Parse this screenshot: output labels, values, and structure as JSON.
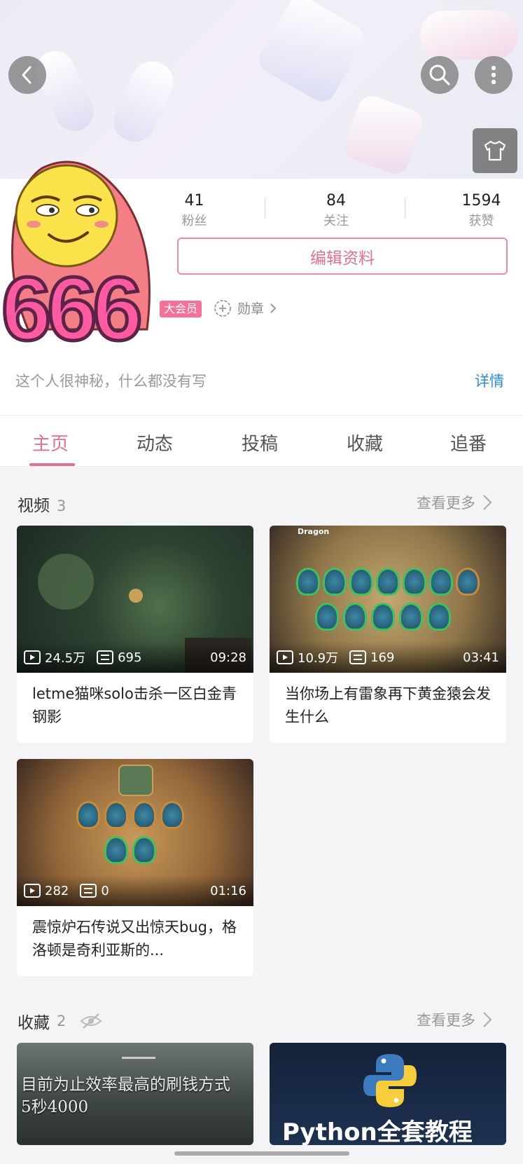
{
  "stats": [
    {
      "value": "41",
      "label": "粉丝"
    },
    {
      "value": "84",
      "label": "关注"
    },
    {
      "value": "1594",
      "label": "获赞"
    }
  ],
  "edit_profile_label": "编辑资料",
  "vip_label": "大会员",
  "medal_label": "勋章",
  "bio": "这个人很神秘，什么都没有写",
  "detail_label": "详情",
  "avatar_text": "666",
  "tabs": [
    "主页",
    "动态",
    "投稿",
    "收藏",
    "追番"
  ],
  "videos_section": {
    "title": "视频",
    "count": "3",
    "see_more": "查看更多"
  },
  "videos": [
    {
      "views": "24.5万",
      "danmaku": "695",
      "duration": "09:28",
      "title": "letme猫咪solo击杀一区白金青钢影"
    },
    {
      "views": "10.9万",
      "danmaku": "169",
      "duration": "03:41",
      "title": "当你场上有雷象再下黄金猿会发生什么"
    },
    {
      "views": "282",
      "danmaku": "0",
      "duration": "01:16",
      "title": "震惊炉石传说又出惊天bug，格洛顿是奇利亚斯的..."
    }
  ],
  "favorites_section": {
    "title": "收藏",
    "count": "2",
    "see_more": "查看更多"
  },
  "favorites": [
    {
      "line1": "目前为止效率最高的刷钱方式",
      "line2": "5秒4000"
    },
    {
      "line1": "Python全套教程"
    }
  ],
  "thumb_texts": {
    "dragon": "Dragon"
  },
  "colors": {
    "accent": "#e0708f",
    "link": "#2c8fd6",
    "vip": "#f5719a"
  }
}
